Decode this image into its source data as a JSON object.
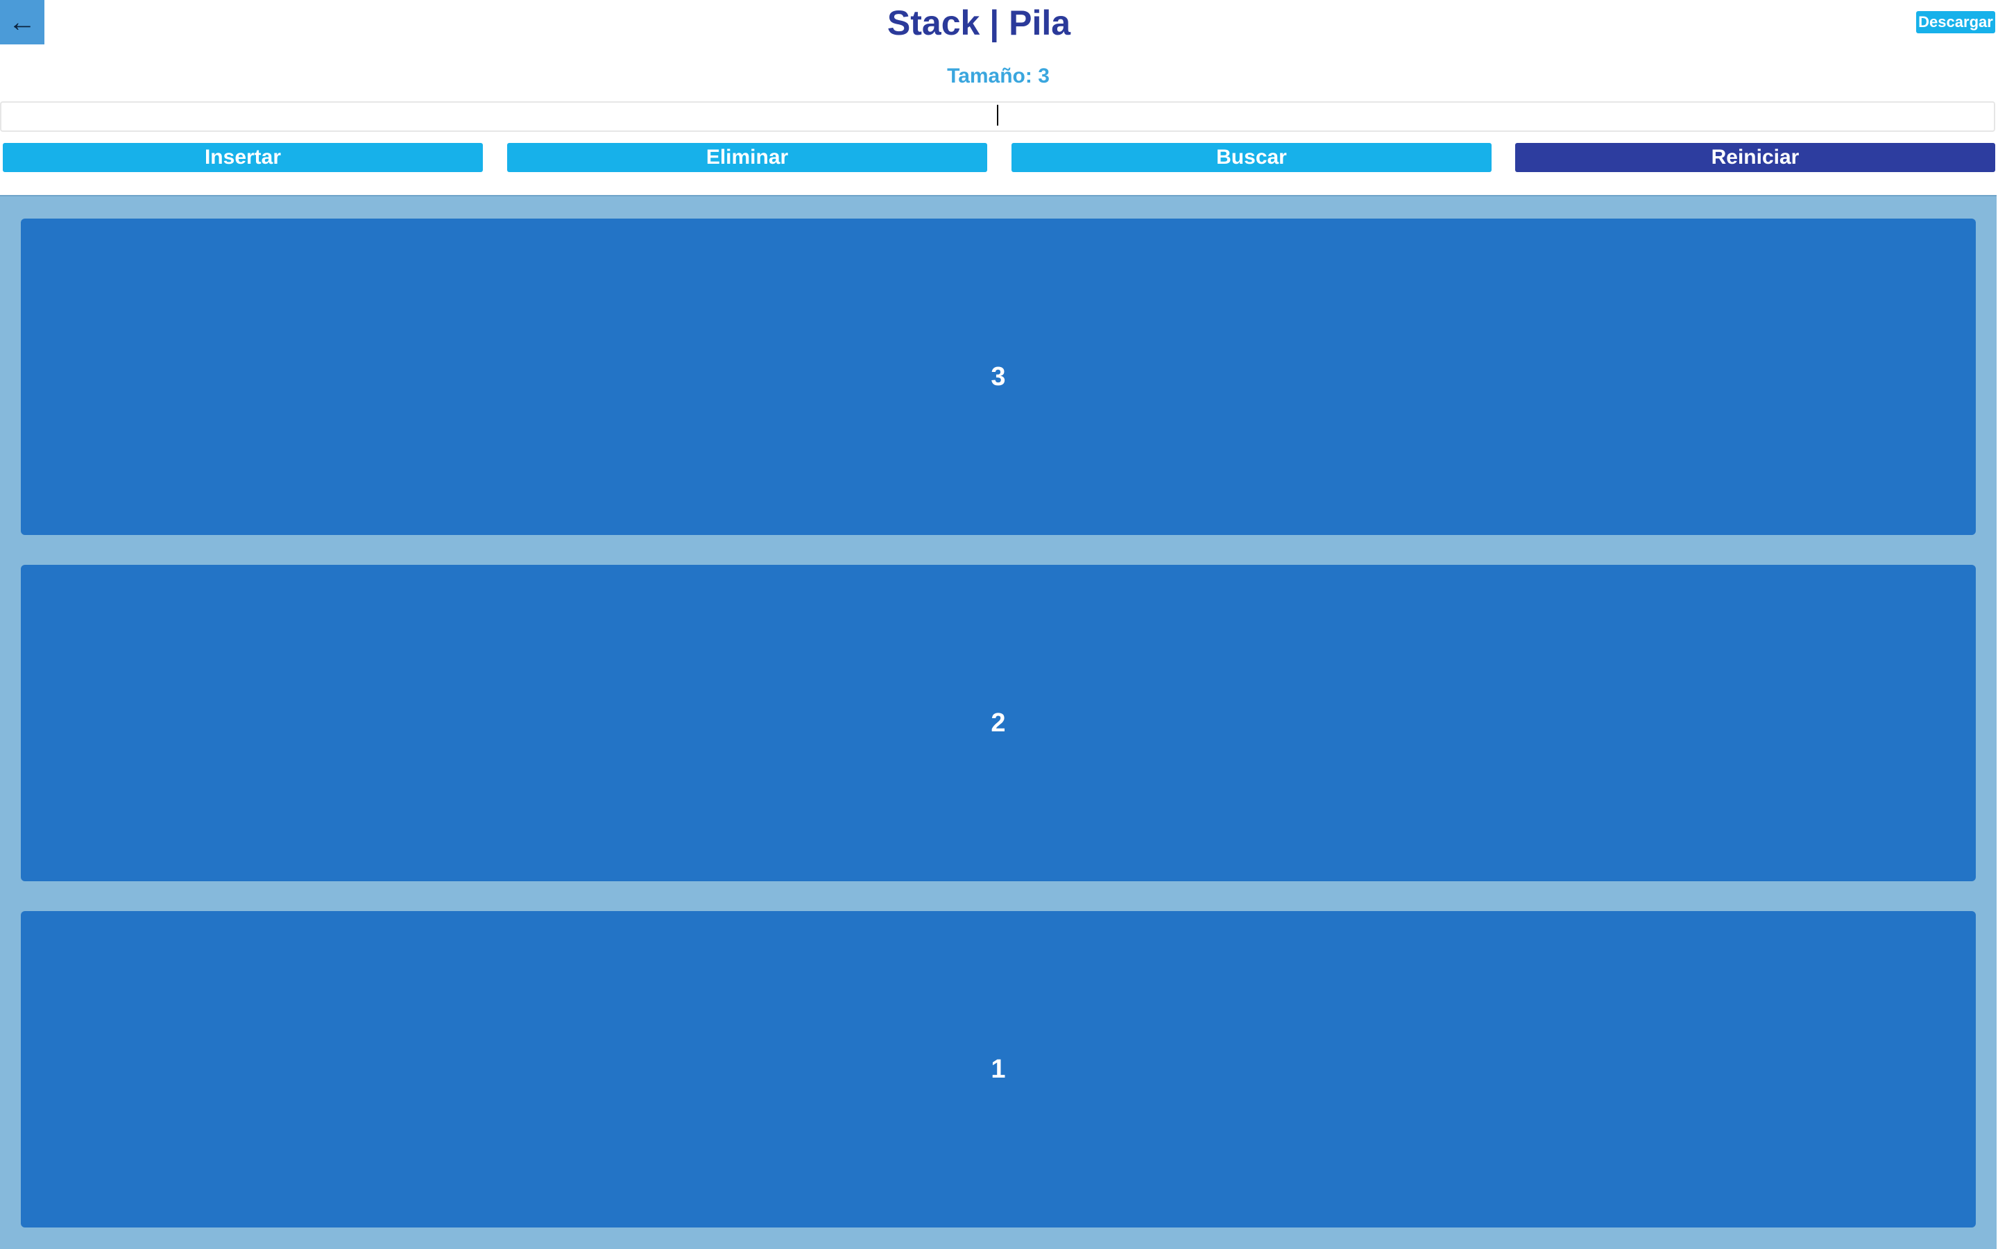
{
  "header": {
    "back_icon": "←",
    "title": "Stack | Pila",
    "download_label": "Descargar"
  },
  "size": {
    "label": "Tamaño: 3"
  },
  "input": {
    "value": "",
    "placeholder": ""
  },
  "actions": {
    "insert_label": "Insertar",
    "delete_label": "Eliminar",
    "search_label": "Buscar",
    "reset_label": "Reiniciar"
  },
  "stack": {
    "items": [
      "3",
      "2",
      "1"
    ]
  },
  "colors": {
    "title": "#2b3a9a",
    "accent": "#17b1ea",
    "reset": "#2d3d9f",
    "stack_bg": "#86b9db",
    "stack_item": "#2374c6",
    "back_button": "#4b9bd8"
  }
}
